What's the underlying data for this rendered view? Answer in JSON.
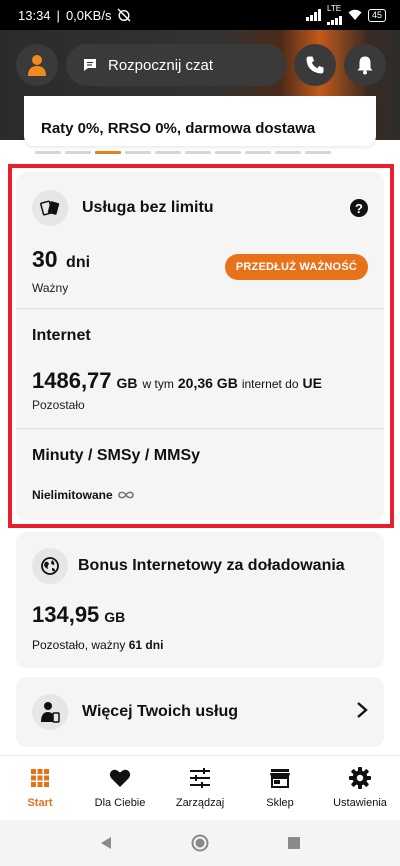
{
  "status_bar": {
    "time": "13:34",
    "speed": "0,0KB/s",
    "network": "LTE",
    "battery": "45"
  },
  "top_bar": {
    "chat_label": "Rozpocznij czat"
  },
  "promo": {
    "text": "Raty 0%, RRSO 0%, darmowa dostawa",
    "active_dot": 2,
    "dot_count": 10
  },
  "service": {
    "title": "Usługa bez limitu",
    "validity_value": "30",
    "validity_unit": "dni",
    "validity_label": "Ważny",
    "extend_button": "PRZEDŁUŻ WAŻNOŚĆ",
    "internet_title": "Internet",
    "internet_value": "1486,77",
    "internet_unit": "GB",
    "internet_text_1": "w tym",
    "internet_eu_value": "20,36 GB",
    "internet_text_2": "internet do",
    "internet_eu": "UE",
    "internet_label": "Pozostało",
    "minutes_title": "Minuty / SMSy / MMSy",
    "minutes_value": "Nielimitowane"
  },
  "bonus": {
    "title": "Bonus Internetowy za doładowania",
    "value": "134,95",
    "unit": "GB",
    "label_prefix": "Pozostało, ważny",
    "label_days": "61 dni"
  },
  "more": {
    "title": "Więcej Twoich usług"
  },
  "bottom_nav": [
    {
      "label": "Start",
      "icon": "grid-icon",
      "active": true
    },
    {
      "label": "Dla Ciebie",
      "icon": "heart-icon"
    },
    {
      "label": "Zarządzaj",
      "icon": "sliders-icon"
    },
    {
      "label": "Sklep",
      "icon": "store-icon"
    },
    {
      "label": "Ustawienia",
      "icon": "gear-icon"
    }
  ],
  "colors": {
    "accent": "#e8721a",
    "highlight_frame": "#e8202e",
    "card_bg": "#f5f5f5"
  }
}
